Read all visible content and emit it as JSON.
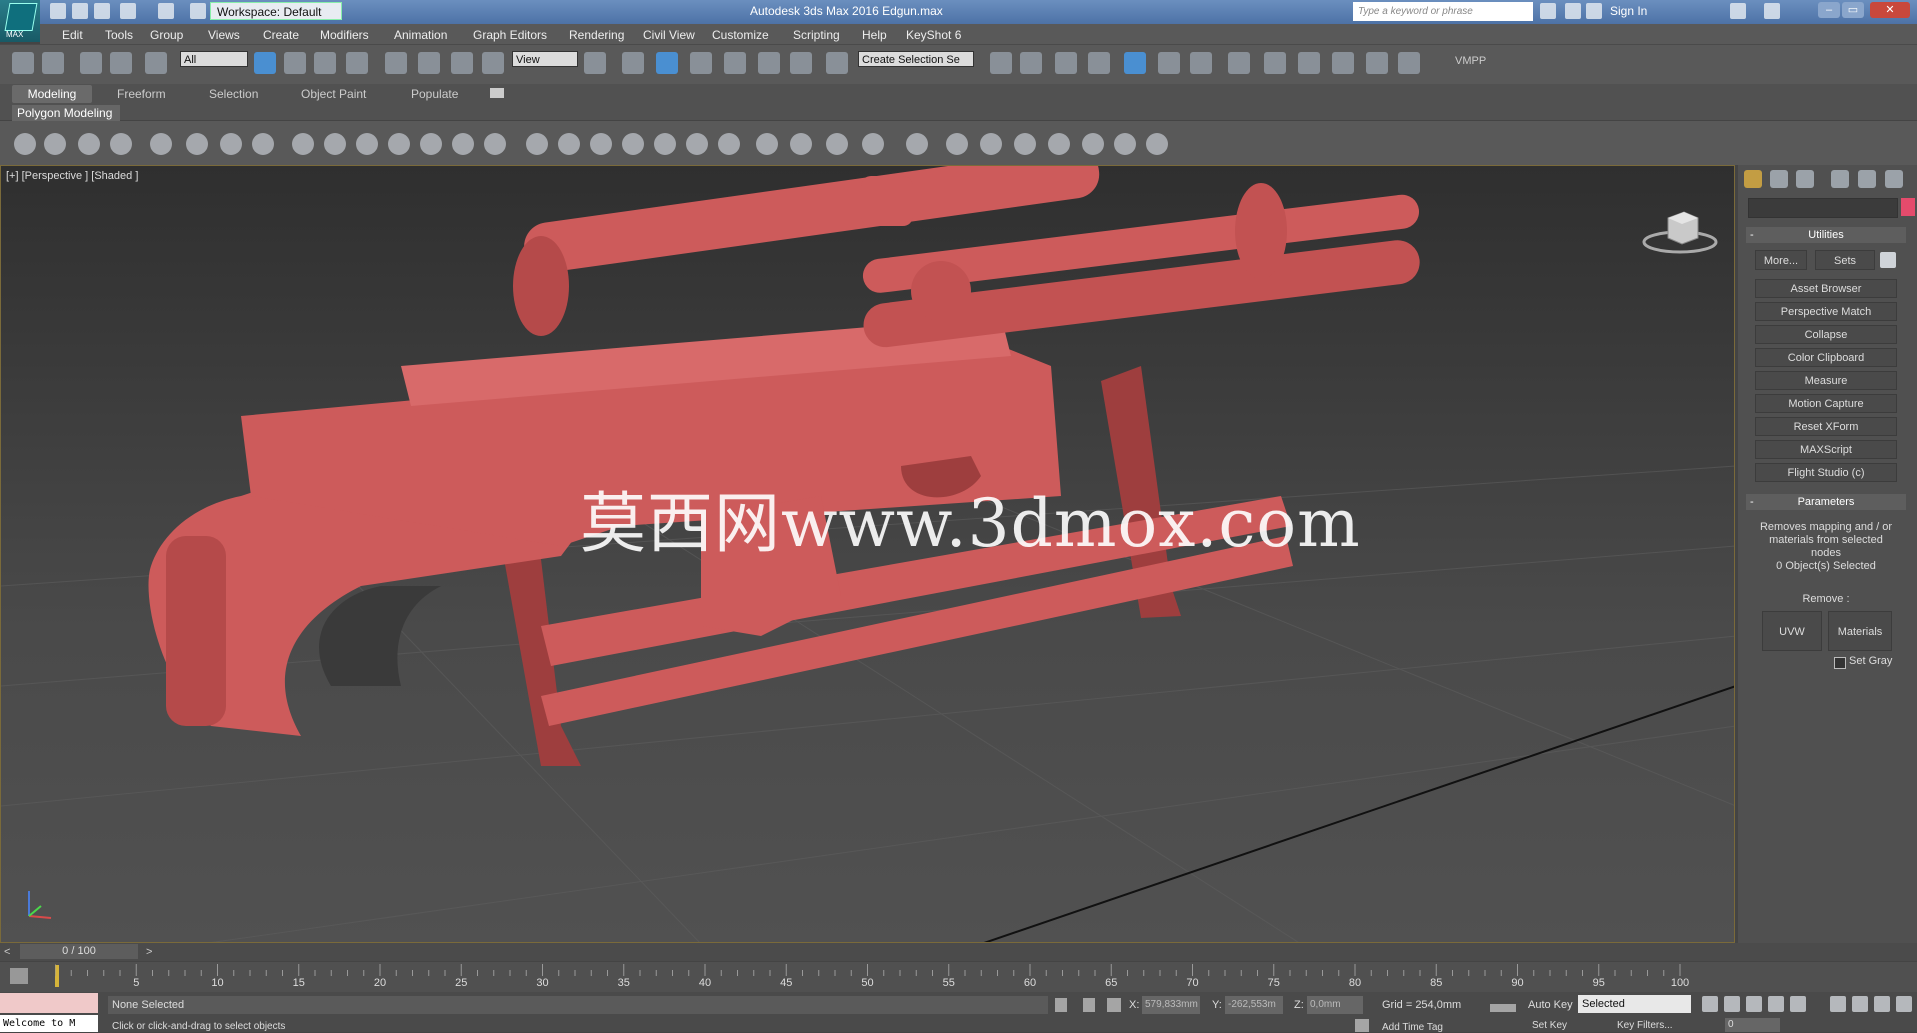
{
  "app": {
    "logo_text": "MAX",
    "workspace": "Workspace: Default",
    "title": "Autodesk 3ds Max 2016     Edgun.max",
    "search_placeholder": "Type a keyword or phrase",
    "sign_in": "Sign In"
  },
  "menu": [
    "Edit",
    "Tools",
    "Group",
    "Views",
    "Create",
    "Modifiers",
    "Animation",
    "Graph Editors",
    "Rendering",
    "Civil View",
    "Customize",
    "Scripting",
    "Help",
    "KeyShot 6"
  ],
  "main_toolbar": {
    "selection_filter": "All",
    "ref_coord": "View",
    "named_selection": "Create Selection Se",
    "vmpp": "VMPP"
  },
  "ribbon": {
    "tabs": [
      "Modeling",
      "Freeform",
      "Selection",
      "Object Paint",
      "Populate"
    ],
    "panel": "Polygon Modeling"
  },
  "viewport": {
    "label": "[+] [Perspective ] [Shaded ]",
    "watermark": "莫西网www.3dmox.com",
    "model_color": "#cd5b5b"
  },
  "command_panel": {
    "utilities_title": "Utilities",
    "more": "More...",
    "sets": "Sets",
    "utilities": [
      "Asset Browser",
      "Perspective Match",
      "Collapse",
      "Color Clipboard",
      "Measure",
      "Motion Capture",
      "Reset XForm",
      "MAXScript",
      "Flight Studio (c)"
    ],
    "parameters_title": "Parameters",
    "param_text": "Removes mapping and / or materials from selected nodes",
    "selected_count": "0 Object(s) Selected",
    "remove_label": "Remove :",
    "uvw": "UVW",
    "materials": "Materials",
    "set_gray": "Set Gray",
    "swatch_color": "#e54b6c"
  },
  "timeline": {
    "slider": "0 / 100",
    "ticks": [
      "5",
      "10",
      "15",
      "20",
      "25",
      "30",
      "35",
      "40",
      "45",
      "50",
      "55",
      "60",
      "65",
      "70",
      "75",
      "80",
      "85",
      "90",
      "95",
      "100"
    ]
  },
  "status": {
    "welcome": "Welcome to M",
    "selection": "None Selected",
    "prompt": "Click or click-and-drag to select objects",
    "x_label": "X:",
    "x_value": "579,833mm",
    "y_label": "Y:",
    "y_value": "-262,553m",
    "z_label": "Z:",
    "z_value": "0,0mm",
    "grid": "Grid = 254,0mm",
    "auto_key": "Auto Key",
    "set_key": "Set Key",
    "selected": "Selected",
    "key_filters": "Key Filters...",
    "add_time_tag": "Add Time Tag",
    "frame": "0"
  }
}
